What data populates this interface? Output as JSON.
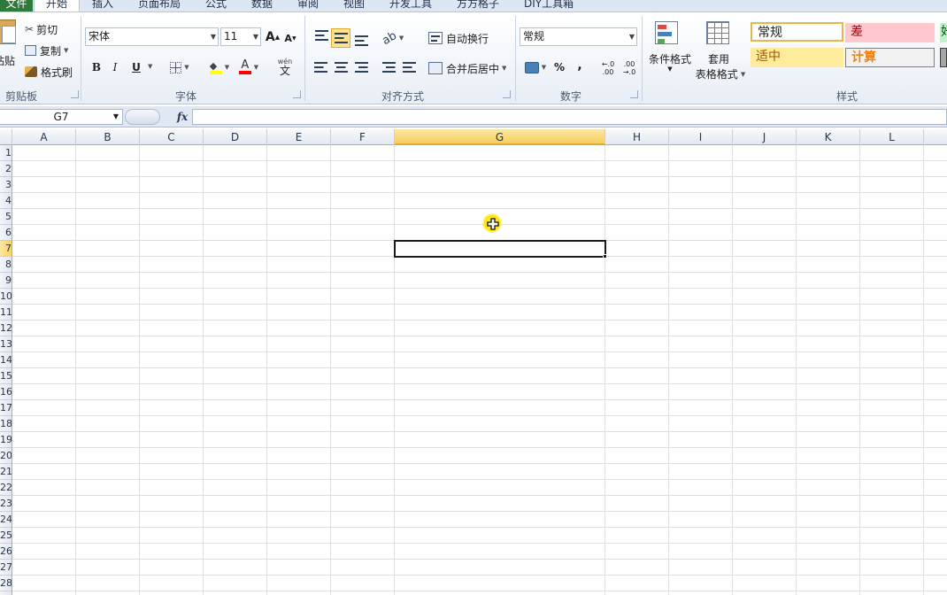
{
  "tabs": {
    "file": "文件",
    "home": "开始",
    "insert": "插入",
    "page_layout": "页面布局",
    "formulas": "公式",
    "data": "数据",
    "review": "审阅",
    "view": "视图",
    "developer": "开发工具",
    "fangfang": "方方格子",
    "diy": "DIY工具箱"
  },
  "clipboard": {
    "paste": "粘贴",
    "cut": "剪切",
    "copy": "复制",
    "format_painter": "格式刷",
    "group_label": "剪贴板"
  },
  "font": {
    "font_name": "宋体",
    "font_size": "11",
    "bold": "B",
    "italic": "I",
    "underline": "U",
    "grow": "A",
    "shrink": "A",
    "font_color_glyph": "A",
    "phonetic_top": "wén",
    "phonetic_bottom": "文",
    "group_label": "字体"
  },
  "alignment": {
    "wrap_text": "自动换行",
    "merge_center": "合并后居中",
    "group_label": "对齐方式"
  },
  "number": {
    "format": "常规",
    "percent": "%",
    "comma": ",",
    "inc_decimal_top": "←.0",
    "inc_decimal_bottom": ".00",
    "dec_decimal_top": ".00",
    "dec_decimal_bottom": "→.0",
    "group_label": "数字"
  },
  "styles": {
    "conditional_format": "条件格式",
    "table_format_line1": "套用",
    "table_format_line2": "表格格式",
    "normal": "常规",
    "bad": "差",
    "good_partial": "好",
    "neutral": "适中",
    "calculation": "计算",
    "group_label": "样式",
    "colors": {
      "normal_border": "#e8b64a",
      "bad_bg": "#ffc7ce",
      "bad_text": "#9c0006",
      "neutral_bg": "#ffeb9c",
      "neutral_text": "#9c5700",
      "calc_bg": "#f2f2f2",
      "calc_text": "#fa7d00"
    }
  },
  "formula_bar": {
    "name_box": "G7",
    "fx": "fx",
    "value": ""
  },
  "grid": {
    "columns": [
      "A",
      "B",
      "C",
      "D",
      "E",
      "F",
      "G",
      "H",
      "I",
      "J",
      "K",
      "L"
    ],
    "selected_column": "G",
    "rows": [
      "1",
      "2",
      "3",
      "4",
      "5",
      "6",
      "7",
      "8",
      "9",
      "10",
      "11",
      "12",
      "13",
      "14",
      "15",
      "16",
      "17",
      "18",
      "19",
      "20",
      "21",
      "22",
      "23",
      "24",
      "25",
      "26",
      "27",
      "28"
    ],
    "selected_row": "7"
  }
}
